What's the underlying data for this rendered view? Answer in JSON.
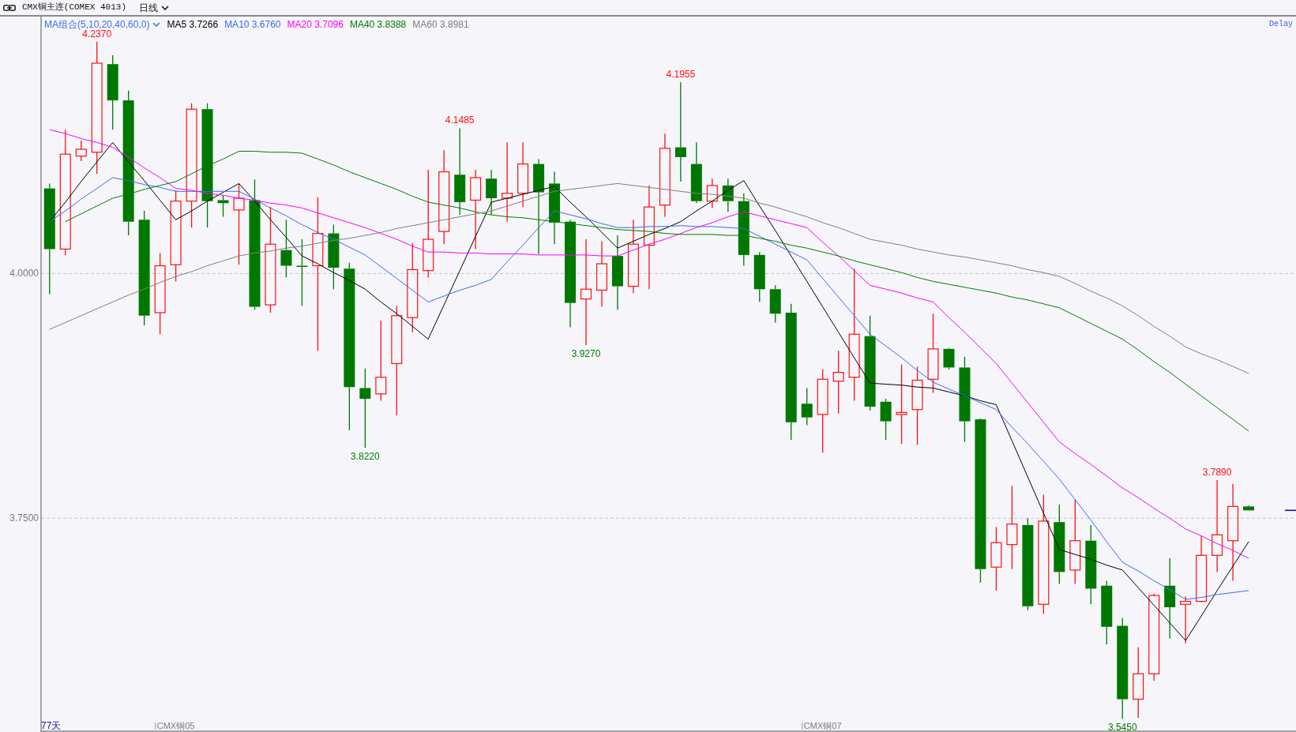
{
  "header": {
    "title": "CMX铜主连(COMEX 4013)",
    "period": "日线"
  },
  "legend": {
    "group": "MA组合(5,10,20,40,60,0)",
    "values": [
      "3.7266",
      "3.6760",
      "3.7096",
      "3.8388",
      "3.8981"
    ]
  },
  "delay": "Delay",
  "bar_count": "77天",
  "chart_data": {
    "type": "candlestick",
    "ylim": [
      3.5315,
      4.2626
    ],
    "yticks": [
      {
        "value": 4.0,
        "label": "4.0000"
      },
      {
        "value": 3.75,
        "label": "3.7500"
      }
    ],
    "categories": [
      null,
      null,
      null,
      null,
      null,
      null,
      null,
      null,
      "CMX铜05",
      null,
      null,
      null,
      null,
      null,
      null,
      null,
      null,
      null,
      null,
      null,
      null,
      null,
      null,
      null,
      null,
      null,
      null,
      null,
      null,
      null,
      null,
      null,
      null,
      null,
      null,
      null,
      null,
      null,
      null,
      null,
      null,
      null,
      null,
      null,
      null,
      null,
      null,
      null,
      null,
      "CMX铜07",
      null,
      null,
      null,
      null,
      null,
      null,
      null,
      null,
      null,
      null,
      null,
      null,
      null,
      null,
      null,
      null,
      null,
      null,
      null,
      null,
      null,
      null,
      null,
      null,
      null,
      null,
      null
    ],
    "series": [
      {
        "name": "MA5",
        "type": "line",
        "color": "#000000",
        "values": [
          4.053,
          4.073,
          4.094,
          4.114,
          4.134,
          4.114,
          4.095,
          4.075,
          4.055,
          4.064,
          4.074,
          4.083,
          4.092,
          4.074,
          4.055,
          4.037,
          4.018,
          4.01,
          4.001,
          3.993,
          3.984,
          3.971,
          3.959,
          3.946,
          3.933,
          3.968,
          4.003,
          4.038,
          4.073,
          4.077,
          4.081,
          4.085,
          4.089,
          4.073,
          4.058,
          4.042,
          4.026,
          4.033,
          4.04,
          4.046,
          4.053,
          4.064,
          4.074,
          4.085,
          4.095,
          4.069,
          4.044,
          4.018,
          3.992,
          3.966,
          3.94,
          3.914,
          3.888,
          3.887,
          3.886,
          3.884,
          3.883,
          3.879,
          3.875,
          3.87,
          3.866,
          3.829,
          3.792,
          3.755,
          3.718,
          3.713,
          3.708,
          3.702,
          3.697,
          3.679,
          3.661,
          3.643,
          3.625,
          3.65,
          3.676,
          3.701,
          3.726
        ]
      },
      {
        "name": "MA10",
        "type": "line",
        "color": "#3c6ee8",
        "values": [
          4.053,
          4.064,
          4.076,
          4.087,
          4.098,
          4.095,
          4.091,
          4.088,
          4.084,
          4.084,
          4.084,
          4.084,
          4.084,
          4.076,
          4.067,
          4.059,
          4.05,
          4.042,
          4.035,
          4.027,
          4.019,
          4.007,
          3.995,
          3.983,
          3.971,
          3.977,
          3.983,
          3.988,
          3.994,
          4.012,
          4.029,
          4.047,
          4.064,
          4.06,
          4.056,
          4.051,
          4.047,
          4.047,
          4.048,
          4.048,
          4.049,
          4.048,
          4.048,
          4.047,
          4.046,
          4.038,
          4.03,
          4.022,
          4.014,
          3.995,
          3.976,
          3.957,
          3.938,
          3.926,
          3.914,
          3.901,
          3.889,
          3.882,
          3.875,
          3.868,
          3.861,
          3.843,
          3.826,
          3.808,
          3.79,
          3.769,
          3.748,
          3.726,
          3.705,
          3.696,
          3.686,
          3.677,
          3.667,
          3.669,
          3.672,
          3.674,
          3.676
        ]
      },
      {
        "name": "MA20",
        "type": "line",
        "color": "#ff00ff",
        "values": [
          4.147,
          4.143,
          4.138,
          4.134,
          4.129,
          4.119,
          4.108,
          4.098,
          4.087,
          4.085,
          4.082,
          4.08,
          4.077,
          4.075,
          4.072,
          4.07,
          4.067,
          4.062,
          4.057,
          4.052,
          4.047,
          4.041,
          4.035,
          4.028,
          4.022,
          4.022,
          4.021,
          4.021,
          4.02,
          4.02,
          4.02,
          4.019,
          4.019,
          4.019,
          4.019,
          4.018,
          4.018,
          4.024,
          4.03,
          4.035,
          4.041,
          4.047,
          4.052,
          4.058,
          4.063,
          4.059,
          4.055,
          4.051,
          4.047,
          4.032,
          4.018,
          4.003,
          3.988,
          3.984,
          3.98,
          3.975,
          3.971,
          3.955,
          3.94,
          3.924,
          3.908,
          3.888,
          3.868,
          3.848,
          3.828,
          3.816,
          3.805,
          3.793,
          3.781,
          3.771,
          3.76,
          3.75,
          3.739,
          3.732,
          3.724,
          3.717,
          3.709
        ]
      },
      {
        "name": "MA40",
        "type": "line",
        "color": "#008000",
        "values": [
          null,
          4.053,
          4.061,
          4.069,
          4.077,
          4.081,
          4.086,
          4.09,
          4.094,
          4.102,
          4.11,
          4.117,
          4.125,
          4.125,
          4.124,
          4.124,
          4.123,
          4.117,
          4.111,
          4.104,
          4.098,
          4.092,
          4.086,
          4.079,
          4.073,
          4.07,
          4.067,
          4.063,
          4.06,
          4.058,
          4.057,
          4.055,
          4.053,
          4.051,
          4.049,
          4.047,
          4.045,
          4.044,
          4.043,
          4.041,
          4.04,
          4.04,
          4.04,
          4.039,
          4.039,
          4.036,
          4.033,
          4.029,
          4.026,
          4.022,
          4.018,
          4.013,
          4.009,
          4.005,
          4.001,
          3.996,
          3.992,
          3.989,
          3.986,
          3.983,
          3.98,
          3.976,
          3.973,
          3.969,
          3.965,
          3.957,
          3.949,
          3.941,
          3.933,
          3.922,
          3.91,
          3.899,
          3.887,
          3.875,
          3.863,
          3.851,
          3.839
        ]
      },
      {
        "name": "MA60",
        "type": "line",
        "color": "#808080",
        "values": [
          3.943,
          3.95,
          3.957,
          3.964,
          3.971,
          3.978,
          3.984,
          3.991,
          3.997,
          4.002,
          4.008,
          4.013,
          4.018,
          4.021,
          4.023,
          4.026,
          4.028,
          4.031,
          4.034,
          4.036,
          4.039,
          4.042,
          4.046,
          4.049,
          4.052,
          4.055,
          4.058,
          4.061,
          4.064,
          4.069,
          4.074,
          4.079,
          4.084,
          4.086,
          4.088,
          4.09,
          4.092,
          4.09,
          4.088,
          4.086,
          4.084,
          4.082,
          4.081,
          4.079,
          4.077,
          4.072,
          4.068,
          4.063,
          4.058,
          4.052,
          4.047,
          4.041,
          4.035,
          4.032,
          4.029,
          4.025,
          4.022,
          4.019,
          4.017,
          4.014,
          4.011,
          4.008,
          4.004,
          4.001,
          3.997,
          3.99,
          3.982,
          3.975,
          3.967,
          3.957,
          3.946,
          3.936,
          3.925,
          3.918,
          3.912,
          3.905,
          3.898
        ]
      }
    ],
    "ohlc": [
      [
        4.087,
        4.092,
        3.979,
        4.025
      ],
      [
        4.025,
        4.147,
        4.019,
        4.122
      ],
      [
        4.12,
        4.136,
        4.115,
        4.127
      ],
      [
        4.124,
        4.237,
        4.102,
        4.215
      ],
      [
        4.214,
        4.223,
        4.147,
        4.177
      ],
      [
        4.177,
        4.187,
        4.039,
        4.053
      ],
      [
        4.055,
        4.064,
        3.947,
        3.957
      ],
      [
        3.96,
        4.021,
        3.938,
        4.008
      ],
      [
        4.009,
        4.085,
        3.992,
        4.074
      ],
      [
        4.074,
        4.174,
        4.047,
        4.168
      ],
      [
        4.168,
        4.174,
        4.047,
        4.074
      ],
      [
        4.075,
        4.08,
        4.058,
        4.072
      ],
      [
        4.065,
        4.092,
        4.009,
        4.077
      ],
      [
        4.075,
        4.096,
        3.963,
        3.966
      ],
      [
        3.968,
        4.068,
        3.96,
        4.03
      ],
      [
        4.024,
        4.055,
        3.996,
        4.008
      ],
      [
        4.008,
        4.035,
        3.967,
        4.007
      ],
      [
        4.008,
        4.078,
        3.921,
        4.041
      ],
      [
        4.041,
        4.05,
        3.984,
        4.006
      ],
      [
        4.005,
        4.011,
        3.84,
        3.884
      ],
      [
        3.883,
        3.903,
        3.822,
        3.872
      ],
      [
        3.877,
        3.952,
        3.87,
        3.894
      ],
      [
        3.908,
        3.967,
        3.855,
        3.957
      ],
      [
        3.955,
        4.031,
        3.94,
        4.004
      ],
      [
        4.003,
        4.106,
        3.996,
        4.035
      ],
      [
        4.043,
        4.126,
        4.03,
        4.104
      ],
      [
        4.101,
        4.1485,
        4.06,
        4.073
      ],
      [
        4.075,
        4.106,
        4.025,
        4.098
      ],
      [
        4.097,
        4.106,
        4.06,
        4.077
      ],
      [
        4.077,
        4.134,
        4.053,
        4.082
      ],
      [
        4.082,
        4.134,
        4.068,
        4.112
      ],
      [
        4.112,
        4.117,
        4.02,
        4.083
      ],
      [
        4.092,
        4.104,
        4.03,
        4.052
      ],
      [
        4.053,
        4.055,
        3.945,
        3.97
      ],
      [
        3.974,
        4.035,
        3.927,
        3.984
      ],
      [
        3.983,
        4.033,
        3.966,
        4.01
      ],
      [
        4.018,
        4.039,
        3.963,
        3.987
      ],
      [
        3.987,
        4.055,
        3.98,
        4.03
      ],
      [
        4.029,
        4.09,
        3.984,
        4.068
      ],
      [
        4.07,
        4.143,
        4.058,
        4.128
      ],
      [
        4.129,
        4.1955,
        4.094,
        4.119
      ],
      [
        4.112,
        4.134,
        4.072,
        4.074
      ],
      [
        4.074,
        4.097,
        4.067,
        4.09
      ],
      [
        4.09,
        4.097,
        4.063,
        4.074
      ],
      [
        4.074,
        4.082,
        4.008,
        4.019
      ],
      [
        4.019,
        4.022,
        3.971,
        3.984
      ],
      [
        3.984,
        3.988,
        3.95,
        3.959
      ],
      [
        3.96,
        3.969,
        3.83,
        3.848
      ],
      [
        3.867,
        3.883,
        3.845,
        3.853
      ],
      [
        3.856,
        3.902,
        3.817,
        3.892
      ],
      [
        3.89,
        3.921,
        3.857,
        3.899
      ],
      [
        3.894,
        4.005,
        3.87,
        3.938
      ],
      [
        3.936,
        3.957,
        3.86,
        3.864
      ],
      [
        3.869,
        3.872,
        3.83,
        3.849
      ],
      [
        3.856,
        3.907,
        3.826,
        3.858
      ],
      [
        3.861,
        3.905,
        3.825,
        3.891
      ],
      [
        3.892,
        3.959,
        3.878,
        3.923
      ],
      [
        3.923,
        3.924,
        3.902,
        3.904
      ],
      [
        3.904,
        3.915,
        3.828,
        3.849
      ],
      [
        3.851,
        3.852,
        3.684,
        3.698
      ],
      [
        3.7,
        3.741,
        3.676,
        3.725
      ],
      [
        3.723,
        3.783,
        3.698,
        3.744
      ],
      [
        3.743,
        3.75,
        3.656,
        3.66
      ],
      [
        3.662,
        3.774,
        3.652,
        3.747
      ],
      [
        3.746,
        3.764,
        3.683,
        3.695
      ],
      [
        3.697,
        3.769,
        3.683,
        3.727
      ],
      [
        3.727,
        3.743,
        3.662,
        3.678
      ],
      [
        3.681,
        3.686,
        3.621,
        3.639
      ],
      [
        3.64,
        3.648,
        3.545,
        3.565
      ],
      [
        3.565,
        3.618,
        3.546,
        3.591
      ],
      [
        3.591,
        3.673,
        3.584,
        3.671
      ],
      [
        3.681,
        3.709,
        3.627,
        3.659
      ],
      [
        3.662,
        3.67,
        3.622,
        3.665
      ],
      [
        3.665,
        3.732,
        3.664,
        3.712
      ],
      [
        3.712,
        3.789,
        3.695,
        3.733
      ],
      [
        3.727,
        3.785,
        3.686,
        3.762
      ],
      [
        3.762,
        3.763,
        3.758,
        3.758
      ]
    ],
    "annotations": [
      {
        "text": "4.2370",
        "y": 4.237
      },
      {
        "text": "4.1485",
        "y": 4.1485
      },
      {
        "text": "4.1955",
        "y": 4.1955
      },
      {
        "text": "3.7890",
        "y": 3.789
      },
      {
        "text": "3.8220",
        "y": 3.822
      },
      {
        "text": "3.9270",
        "y": 3.927
      },
      {
        "text": "3.5450",
        "y": 3.545
      }
    ]
  }
}
